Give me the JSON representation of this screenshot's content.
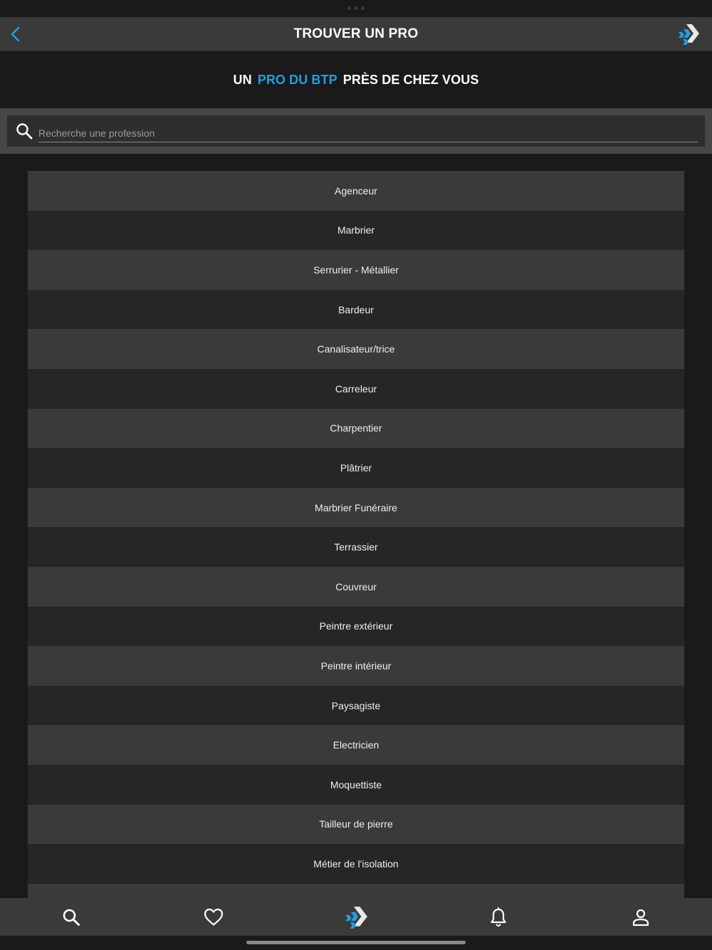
{
  "nav": {
    "title": "TROUVER UN PRO",
    "back_icon": "chevron-left-icon",
    "logo_icon": "brand-logo-icon"
  },
  "headline": {
    "part1": "UN",
    "accent": "PRO DU BTP",
    "part2": "PRÈS DE CHEZ VOUS"
  },
  "search": {
    "placeholder": "Recherche une profession",
    "value": ""
  },
  "professions": [
    "Agenceur",
    "Marbrier",
    "Serrurier - Métallier",
    "Bardeur",
    "Canalisateur/trice",
    "Carreleur",
    "Charpentier",
    "Plâtrier",
    "Marbrier Funéraire",
    "Terrassier",
    "Couvreur",
    "Peintre extérieur",
    "Peintre intérieur",
    "Paysagiste",
    "Electricien",
    "Moquettiste",
    "Tailleur de pierre",
    "Métier de l'isolation",
    ""
  ],
  "tab_bar": {
    "tabs": [
      {
        "icon": "search-icon"
      },
      {
        "icon": "heart-icon"
      },
      {
        "icon": "brand-logo-icon"
      },
      {
        "icon": "bell-icon"
      },
      {
        "icon": "user-icon"
      }
    ]
  },
  "colors": {
    "accent": "#1ea0e6",
    "background": "#1a1a1a",
    "bar": "#3a3a3a",
    "row_light": "#3a3a3a",
    "row_dark": "#262626"
  }
}
